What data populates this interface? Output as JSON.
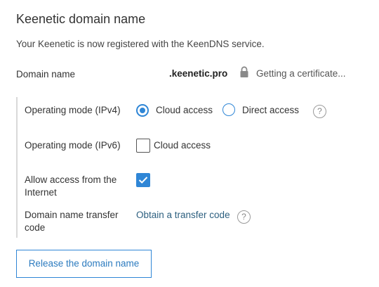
{
  "header": {
    "title": "Keenetic domain name",
    "subtitle": "Your Keenetic is now registered with the KeenDNS service."
  },
  "domain": {
    "label": "Domain name",
    "value": ".keenetic.pro",
    "status": "Getting a certificate...",
    "status_icon": "lock-icon"
  },
  "ipv4": {
    "label": "Operating mode (IPv4)",
    "options": [
      {
        "label": "Cloud access",
        "selected": true
      },
      {
        "label": "Direct access",
        "selected": false
      }
    ],
    "help_icon": "?"
  },
  "ipv6": {
    "label": "Operating mode (IPv6)",
    "checkbox_label": "Cloud access",
    "checked": false
  },
  "internet_access": {
    "label_line1": "Allow access from the",
    "label_line2": "Internet",
    "checked": true
  },
  "transfer": {
    "label_line1": "Domain name transfer",
    "label_line2": "code",
    "link": "Obtain a transfer code",
    "help_icon": "?"
  },
  "actions": {
    "release_label": "Release the domain name"
  },
  "colors": {
    "accent": "#2f86d6",
    "link": "#2c5f7f",
    "divider": "#d9d9d9"
  }
}
